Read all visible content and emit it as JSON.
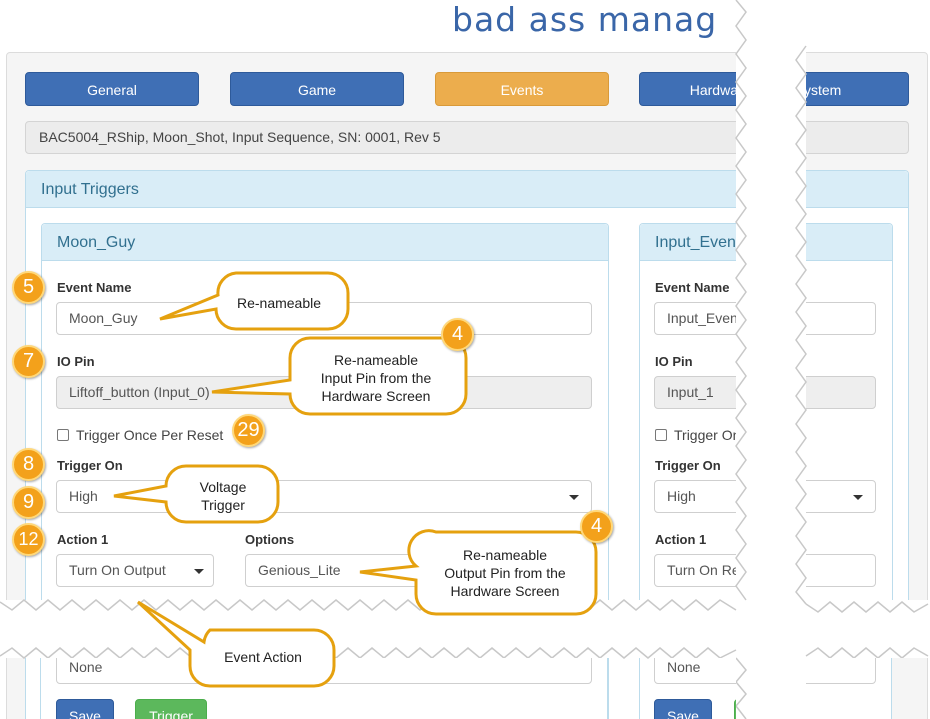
{
  "brand": {
    "text": "bad ass manag"
  },
  "tabs": [
    {
      "label": "General"
    },
    {
      "label": "Game"
    },
    {
      "label": "Events"
    },
    {
      "label": "Hardwa"
    },
    {
      "label": "ystem"
    }
  ],
  "infobar": {
    "text": "BAC5004_RShip, Moon_Shot, Input Sequence, SN: 0001, Rev 5"
  },
  "section": {
    "title": "Input Triggers"
  },
  "left_panel": {
    "title": "Moon_Guy",
    "event_name_label": "Event Name",
    "event_name_value": "Moon_Guy",
    "io_pin_label": "IO Pin",
    "io_pin_value": "Liftoff_button (Input_0)",
    "trigger_once_label": "Trigger Once Per Reset",
    "trigger_on_label": "Trigger On",
    "trigger_on_value": "High",
    "action1_label": "Action 1",
    "action1_value": "Turn On Output",
    "options_label": "Options",
    "options_value": "Genious_Lite",
    "lower_value": "None",
    "save_label": "Save",
    "trigger_label": "Trigger"
  },
  "right_panel": {
    "title": "Input_Event",
    "event_name_label": "Event Name",
    "event_name_value": "Input_Event_",
    "io_pin_label": "IO Pin",
    "io_pin_value": "Input_1",
    "trigger_once_label": "Trigger Onc",
    "trigger_on_label": "Trigger On",
    "trigger_on_value": "High",
    "action1_label": "Action 1",
    "action1_value": "Turn On Rela",
    "lower_value": "None",
    "save_label": "Save"
  },
  "badges": {
    "b5": "5",
    "b7": "7",
    "b4a": "4",
    "b29": "29",
    "b8": "8",
    "b9": "9",
    "b12": "12",
    "b4b": "4"
  },
  "callouts": {
    "renameable": "Re-nameable",
    "input_pin_l1": "Re-nameable",
    "input_pin_l2": "Input Pin from the",
    "input_pin_l3": "Hardware Screen",
    "voltage_l1": "Voltage",
    "voltage_l2": "Trigger",
    "output_pin_l1": "Re-nameable",
    "output_pin_l2": "Output Pin from the",
    "output_pin_l3": "Hardware Screen",
    "event_action": "Event Action"
  },
  "colors": {
    "tab_blue": "#3f6fb5",
    "tab_active": "#ecad4d",
    "panel_header": "#d9edf7",
    "badge_orange": "#f3a11b",
    "callout_border": "#e5a10f",
    "save_blue": "#3f6fb5",
    "trigger_green": "#5cb85c"
  }
}
